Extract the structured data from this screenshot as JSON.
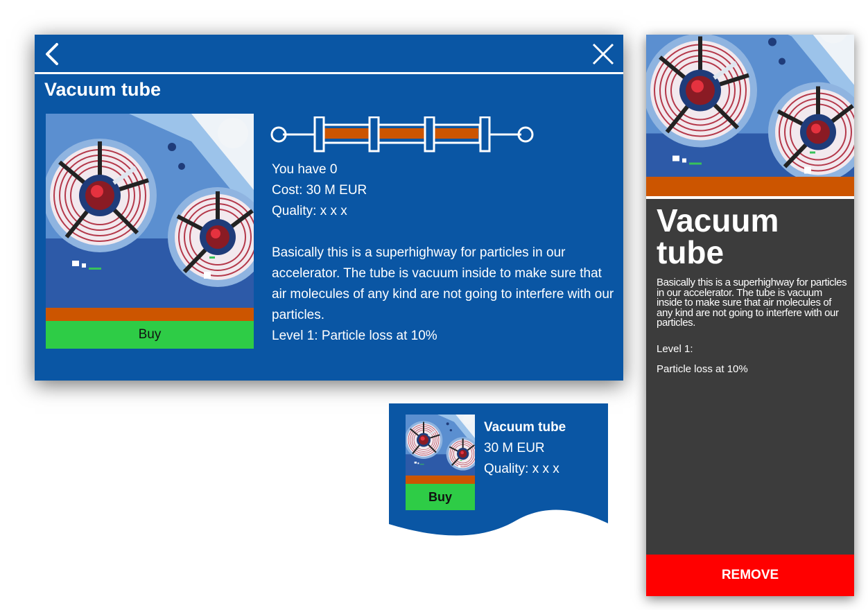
{
  "colors": {
    "dialog_bg": "#0a56a4",
    "panel_bg": "#3c3c3c",
    "accent_bar": "#cc5500",
    "buy_green": "#2ecc46",
    "remove_red": "#ff0000",
    "white": "#ffffff"
  },
  "icons": {
    "back": "chevron-left-icon",
    "close": "close-icon",
    "tube": "vacuum-tube-diagram-icon"
  },
  "dialog": {
    "title": "Vacuum tube",
    "buy_label": "Buy",
    "you_have": "You have 0",
    "cost": "Cost: 30 M EUR",
    "quality": "Quality: x x x",
    "description": "Basically this is a superhighway for particles in our accelerator. The tube is vacuum inside to make sure that air molecules of any kind are not going to interfere with our particles.",
    "level": "Level 1: Particle loss at 10%"
  },
  "card": {
    "name": "Vacuum tube",
    "price": "30 M EUR",
    "quality": "Quality: x x x",
    "buy_label": "Buy"
  },
  "panel": {
    "title": "Vacuum tube",
    "description": "Basically this is a superhighway for particles in our accelerator. The tube is vacuum inside to make sure that air molecules of any kind are not going to interfere with our particles.",
    "level": "Level 1:",
    "loss": "Particle loss at 10%",
    "remove_label": "REMOVE"
  }
}
